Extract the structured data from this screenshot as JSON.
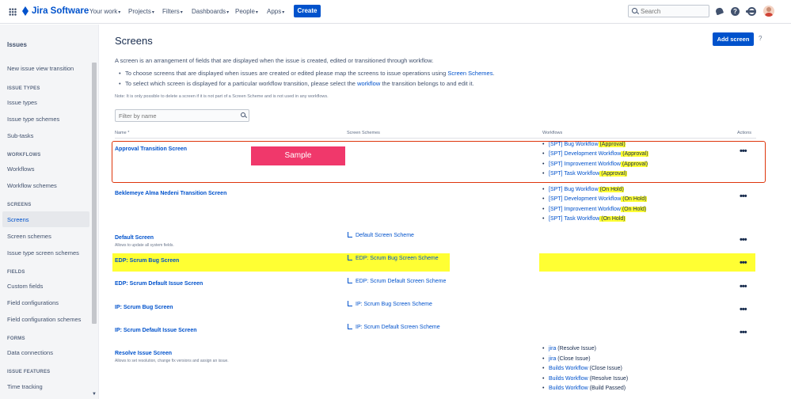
{
  "topnav": {
    "brand": "Jira Software",
    "items": [
      {
        "label": "Your work"
      },
      {
        "label": "Projects"
      },
      {
        "label": "Filters"
      },
      {
        "label": "Dashboards"
      },
      {
        "label": "People"
      },
      {
        "label": "Apps"
      }
    ],
    "create_label": "Create",
    "search_placeholder": "Search",
    "help_glyph": "?"
  },
  "sidebar": {
    "title": "Issues",
    "items": [
      {
        "label": "New issue view transition"
      },
      {
        "header": "ISSUE TYPES"
      },
      {
        "label": "Issue types"
      },
      {
        "label": "Issue type schemes"
      },
      {
        "label": "Sub-tasks"
      },
      {
        "header": "WORKFLOWS"
      },
      {
        "label": "Workflows"
      },
      {
        "label": "Workflow schemes"
      },
      {
        "header": "SCREENS"
      },
      {
        "label": "Screens"
      },
      {
        "label": "Screen schemes"
      },
      {
        "label": "Issue type screen schemes"
      },
      {
        "header": "FIELDS"
      },
      {
        "label": "Custom fields"
      },
      {
        "label": "Field configurations"
      },
      {
        "label": "Field configuration schemes"
      },
      {
        "header": "FORMS"
      },
      {
        "label": "Data connections"
      },
      {
        "header": "ISSUE FEATURES"
      },
      {
        "label": "Time tracking"
      }
    ],
    "active": "Screens"
  },
  "main": {
    "title": "Screens",
    "add_button": "Add screen",
    "help": "?",
    "description": "A screen is an arrangement of fields that are displayed when the issue is created, edited or transitioned through workflow.",
    "bullet1_pre": "To choose screens that are displayed when issues are created or edited please map the screens to issue operations using ",
    "bullet1_link": "Screen Schemes",
    "bullet1_post": ".",
    "bullet2_pre": "To select which screen is displayed for a particular workflow transition, please select the ",
    "bullet2_link": "workflow",
    "bullet2_post": " the transition belongs to and edit it.",
    "note": "Note: It is only possible to delete a screen if it is not part of a Screen Scheme and is not used in any workflows.",
    "filter_placeholder": "Filter by name",
    "columns": {
      "name": "Name",
      "schemes": "Screen Schemes",
      "workflows": "Workflows",
      "actions": "Actions"
    },
    "sample_label": "Sample",
    "actions_glyph": "•••",
    "rows": [
      {
        "name": "Approval Transition Screen",
        "sub": "",
        "scheme": "",
        "workflows": [
          {
            "name": "[SPT] Bug Workflow",
            "suffix": " (Approval)"
          },
          {
            "name": "[SPT] Development Workflow",
            "suffix": " (Approval)"
          },
          {
            "name": "[SPT] Improvement Workflow",
            "suffix": " (Approval)"
          },
          {
            "name": "[SPT] Task Workflow",
            "suffix": " (Approval)"
          }
        ]
      },
      {
        "name": "Beklemeye Alma Nedeni Transition Screen",
        "sub": "",
        "scheme": "",
        "workflows": [
          {
            "name": "[SPT] Bug Workflow",
            "suffix": " (On Hold)"
          },
          {
            "name": "[SPT] Development Workflow",
            "suffix": " (On Hold)"
          },
          {
            "name": "[SPT] Improvement Workflow",
            "suffix": " (On Hold)"
          },
          {
            "name": "[SPT] Task Workflow",
            "suffix": " (On Hold)"
          }
        ]
      },
      {
        "name": "Default Screen",
        "sub": "Allows to update all system fields.",
        "scheme": "Default Screen Scheme",
        "workflows": []
      },
      {
        "name": "EDP: Scrum Bug Screen",
        "sub": "",
        "scheme": "EDP: Scrum Bug Screen Scheme",
        "workflows": []
      },
      {
        "name": "EDP: Scrum Default Issue Screen",
        "sub": "",
        "scheme": "EDP: Scrum Default Screen Scheme",
        "workflows": []
      },
      {
        "name": "IP: Scrum Bug Screen",
        "sub": "",
        "scheme": "IP: Scrum Bug Screen Scheme",
        "workflows": []
      },
      {
        "name": "IP: Scrum Default Issue Screen",
        "sub": "",
        "scheme": "IP: Scrum Default Screen Scheme",
        "workflows": []
      },
      {
        "name": "Resolve Issue Screen",
        "sub": "Allows to set resolution, change fix versions and assign an issue.",
        "scheme": "",
        "workflows": [
          {
            "name": "jira",
            "suffix": " (Resolve Issue)"
          },
          {
            "name": "jira",
            "suffix": " (Close Issue)"
          },
          {
            "name": "Builds Workflow",
            "suffix": " (Close Issue)"
          },
          {
            "name": "Builds Workflow",
            "suffix": " (Resolve Issue)"
          },
          {
            "name": "Builds Workflow",
            "suffix": " (Build Passed)"
          }
        ]
      }
    ]
  },
  "colors": {
    "accent": "#0052cc",
    "highlight": "#ffff33",
    "sample": "#f0386b",
    "outline": "#de350b"
  }
}
